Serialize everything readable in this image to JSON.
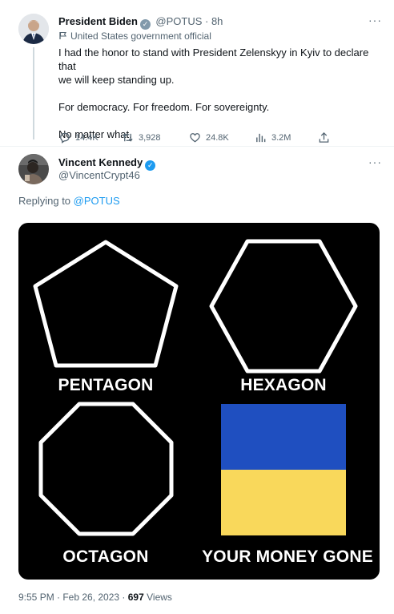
{
  "tweet1": {
    "author_name": "President Biden",
    "handle_time": "@POTUS · 8h",
    "affiliation": "United States government official",
    "text_line1": "I had the honor to stand with President Zelenskyy in Kyiv to declare that",
    "text_line2": "we will keep standing up.",
    "text_para2": "For democracy. For freedom. For sovereignty.",
    "text_para3": "No matter what.",
    "replies": "14.4K",
    "retweets": "3,928",
    "likes": "24.8K",
    "views": "3.2M",
    "more": "···"
  },
  "tweet2": {
    "author_name": "Vincent Kennedy",
    "handle": "@VincentCrypt46",
    "replying_prefix": "Replying to",
    "replying_handle": "@POTUS",
    "more": "···",
    "meme": {
      "labels": [
        "PENTAGON",
        "HEXAGON",
        "OCTAGON",
        "YOUR MONEY GONE"
      ],
      "flag_colors": {
        "top": "#1f4fc0",
        "bottom": "#f9d85b"
      }
    },
    "timestamp": "9:55 PM · Feb 26, 2023 ·",
    "view_count": "697",
    "views_label": "Views"
  },
  "icons": {
    "verified": "verified-badge-icon",
    "gov": "government-badge-icon",
    "flag": "flag-icon",
    "reply": "reply-icon",
    "retweet": "retweet-icon",
    "like": "heart-icon",
    "views": "views-chart-icon",
    "share": "share-icon"
  }
}
